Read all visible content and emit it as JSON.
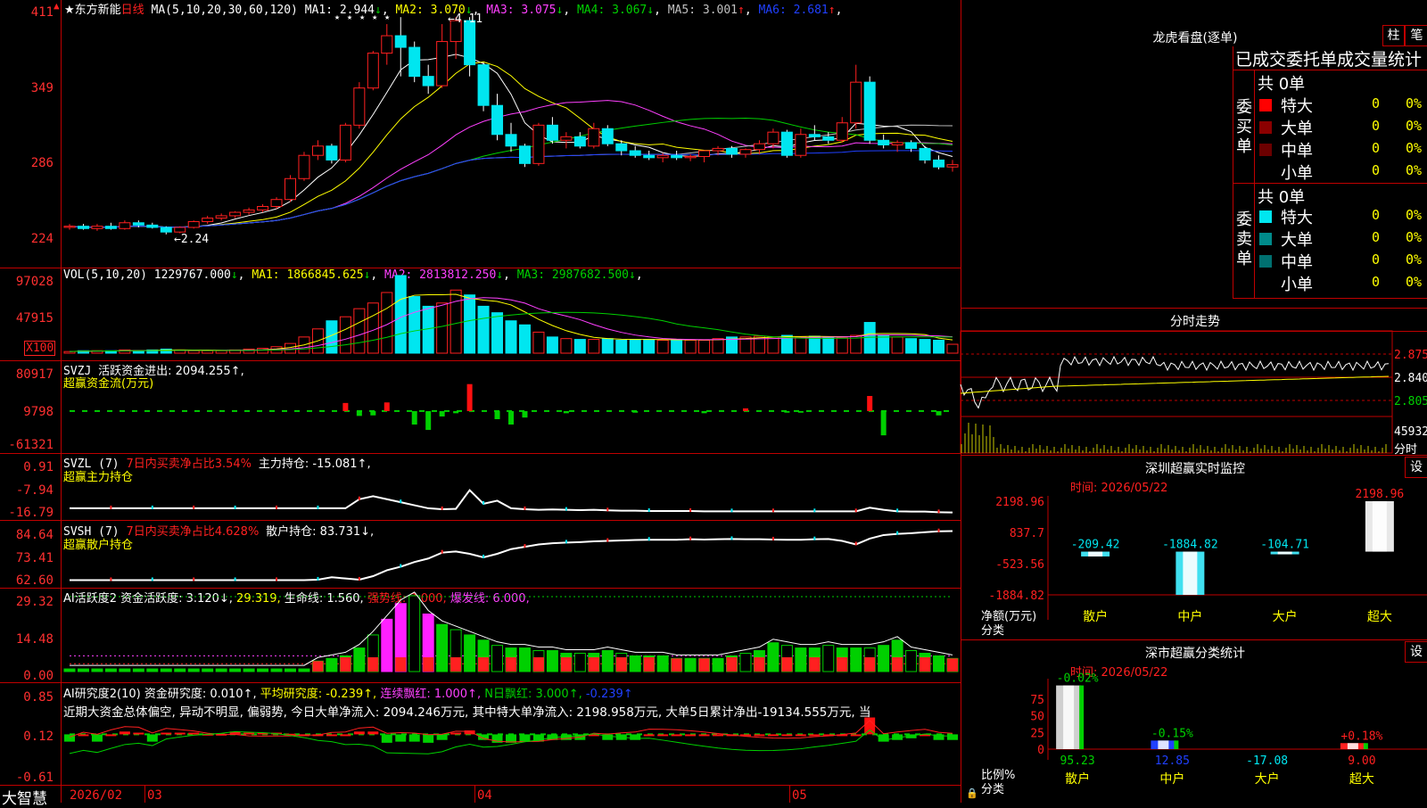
{
  "app": {
    "name": "大智慧",
    "period": "日线"
  },
  "stock": {
    "name": "东方新能"
  },
  "colors": {
    "up": "#ff2020",
    "down": "#00e6f0",
    "grid": "#c00000",
    "ma1": "#ffffff",
    "ma2": "#ffff00",
    "ma3": "#ff40ff",
    "ma4": "#00d000",
    "ma5": "#c0c0c0",
    "ma6": "#2040ff"
  },
  "kline": {
    "ma_title": "MA(5,10,20,30,60,120)",
    "ma_values": [
      {
        "label": "MA1:",
        "value": "2.944",
        "arrow": "↓",
        "color": "#ffffff"
      },
      {
        "label": "MA2:",
        "value": "3.070",
        "arrow": "↓",
        "color": "#ffff00"
      },
      {
        "label": "MA3:",
        "value": "3.075",
        "arrow": "↓",
        "color": "#ff40ff"
      },
      {
        "label": "MA4:",
        "value": "3.067",
        "arrow": "↓",
        "color": "#00d000"
      },
      {
        "label": "MA5:",
        "value": "3.001",
        "arrow": "↑",
        "color": "#c0c0c0"
      },
      {
        "label": "MA6:",
        "value": "2.681",
        "arrow": "↑",
        "color": "#2040ff"
      }
    ],
    "y_labels": [
      "411",
      "349",
      "286",
      "224"
    ],
    "high_mark": "4.11",
    "low_mark": "2.24",
    "stars": "★ ★ ★ ★   ★"
  },
  "vol": {
    "title": "VOL(5,10,20)",
    "value": "1229767.000",
    "ma": [
      {
        "label": "MA1:",
        "value": "1866845.625",
        "arrow": "↓",
        "color": "#ffff00"
      },
      {
        "label": "MA2:",
        "value": "2813812.250",
        "arrow": "↓",
        "color": "#ff40ff"
      },
      {
        "label": "MA3:",
        "value": "2987682.500",
        "arrow": "↓",
        "color": "#00d000"
      }
    ],
    "y_labels": [
      "97028",
      "47915"
    ],
    "unit": "X100"
  },
  "svzj": {
    "title": "SVZJ",
    "line1": "活跃资金进出: 2094.255↑,",
    "line2": "超赢资金流(万元)",
    "y_labels": [
      "80917",
      "9798",
      "-61321"
    ]
  },
  "svzl": {
    "title": "SVZL (7)",
    "ratio": "7日内买卖净占比3.54%",
    "main_hold": "主力持仓: -15.081↑,",
    "line2": "超赢主力持仓",
    "y_labels": [
      "0.91",
      "-7.94",
      "-16.79"
    ]
  },
  "svsh": {
    "title": "SVSH (7)",
    "ratio": "7日内买卖净占比4.628%",
    "retail_hold": "散户持仓: 83.731↓,",
    "line2": "超赢散户持仓",
    "y_labels": [
      "84.64",
      "73.41",
      "62.60"
    ]
  },
  "ai_active": {
    "title": "AI活跃度2",
    "fund": "资金活跃度: 3.120↓,",
    "v2": "29.319,",
    "life": "生命线: 1.560,",
    "strong": "强势线: 3.000,",
    "burst": "爆发线: 6.000,",
    "y_labels": [
      "29.32",
      "14.48",
      "0.00"
    ]
  },
  "ai_research": {
    "title": "AI研究度2(10)",
    "fund": "资金研究度: 0.010↑,",
    "avg": "平均研究度: -0.239↑,",
    "red": "连续飘红: 1.000↑,",
    "nred": "N日飘红: 3.000↑,",
    "last": "-0.239↑",
    "comment": "近期大资金总体偏空, 异动不明显, 偏弱势, 今日大单净流入: 2094.246万元, 其中特大单净流入: 2198.958万元, 大单5日累计净出-19134.555万元, 当",
    "y_labels": [
      "0.85",
      "0.12",
      "-0.61"
    ]
  },
  "time_axis": {
    "brand": "大智慧",
    "labels": [
      "2026/02",
      "03",
      "04",
      "05"
    ]
  },
  "right": {
    "lhb_title": "龙虎看盘(逐单)",
    "btn1": "柱",
    "btn2": "笔",
    "stats_title": "已成交委托单成交量统计",
    "buy": {
      "side": "委买单",
      "total": "共 0单",
      "rows": [
        {
          "color": "#ff0000",
          "label": "特大",
          "count": "0",
          "pct": "0%"
        },
        {
          "color": "#8b0000",
          "label": "大单",
          "count": "0",
          "pct": "0%"
        },
        {
          "color": "#6b0000",
          "label": "中单",
          "count": "0",
          "pct": "0%"
        },
        {
          "color": "",
          "label": "小单",
          "count": "0",
          "pct": "0%"
        }
      ]
    },
    "sell": {
      "side": "委卖单",
      "total": "共 0单",
      "rows": [
        {
          "color": "#00e6f0",
          "label": "特大",
          "count": "0",
          "pct": "0%"
        },
        {
          "color": "#008b8b",
          "label": "大单",
          "count": "0",
          "pct": "0%"
        },
        {
          "color": "#007070",
          "label": "中单",
          "count": "0",
          "pct": "0%"
        },
        {
          "color": "",
          "label": "小单",
          "count": "0",
          "pct": "0%"
        }
      ]
    },
    "intraday": {
      "title": "分时走势",
      "prices": [
        "2.875",
        "2.840",
        "2.805"
      ],
      "vol": "45932",
      "vol_unit": "分时"
    },
    "sz_monitor": {
      "title": "深圳超赢实时监控",
      "btn": "设",
      "time": "时间: 2026/05/22",
      "y_labels": [
        "2198.96",
        "837.7",
        "-523.56",
        "-1884.82"
      ],
      "ylabel1": "净额(万元)",
      "ylabel2": "分类",
      "bars": [
        {
          "cat": "散户",
          "value": -209.42,
          "label": "-209.42"
        },
        {
          "cat": "中户",
          "value": -1884.82,
          "label": "-1884.82"
        },
        {
          "cat": "大户",
          "value": -104.71,
          "label": "-104.71"
        },
        {
          "cat": "超大",
          "value": 2198.96,
          "label": "2198.96"
        }
      ]
    },
    "sz_class": {
      "title": "深市超赢分类统计",
      "btn": "设",
      "time": "时间: 2026/05/22",
      "y_ticks": [
        "75",
        "50",
        "25",
        "0"
      ],
      "ylabel1": "比例%",
      "ylabel2": "分类",
      "bars": [
        {
          "cat": "散户",
          "value": 95.23,
          "label": "95.23",
          "chg": "-0.02%"
        },
        {
          "cat": "中户",
          "value": 12.85,
          "label": "12.85",
          "chg": "-0.15%"
        },
        {
          "cat": "大户",
          "value": -17.08,
          "label": "-17.08",
          "chg": ""
        },
        {
          "cat": "超大",
          "value": 9.0,
          "label": "9.00",
          "chg": "+0.18%"
        }
      ]
    }
  },
  "chart_data": [
    {
      "type": "candlestick",
      "title": "东方新能 日线",
      "ylim": [
        2.2,
        4.15
      ],
      "ohlc": [
        [
          2.3,
          2.33,
          2.28,
          2.31
        ],
        [
          2.31,
          2.33,
          2.28,
          2.29
        ],
        [
          2.29,
          2.33,
          2.27,
          2.31
        ],
        [
          2.31,
          2.34,
          2.28,
          2.29
        ],
        [
          2.29,
          2.36,
          2.28,
          2.34
        ],
        [
          2.34,
          2.36,
          2.3,
          2.32
        ],
        [
          2.32,
          2.34,
          2.29,
          2.3
        ],
        [
          2.3,
          2.31,
          2.24,
          2.26
        ],
        [
          2.26,
          2.31,
          2.25,
          2.3
        ],
        [
          2.3,
          2.36,
          2.29,
          2.35
        ],
        [
          2.35,
          2.4,
          2.33,
          2.38
        ],
        [
          2.38,
          2.42,
          2.36,
          2.4
        ],
        [
          2.4,
          2.44,
          2.38,
          2.43
        ],
        [
          2.43,
          2.47,
          2.41,
          2.45
        ],
        [
          2.45,
          2.5,
          2.43,
          2.48
        ],
        [
          2.48,
          2.56,
          2.46,
          2.54
        ],
        [
          2.54,
          2.75,
          2.52,
          2.72
        ],
        [
          2.72,
          2.95,
          2.7,
          2.92
        ],
        [
          2.92,
          3.05,
          2.88,
          3.0
        ],
        [
          3.0,
          3.02,
          2.85,
          2.88
        ],
        [
          2.88,
          3.2,
          2.86,
          3.18
        ],
        [
          3.18,
          3.55,
          3.15,
          3.5
        ],
        [
          3.5,
          3.82,
          3.48,
          3.8
        ],
        [
          3.8,
          4.05,
          3.7,
          3.95
        ],
        [
          3.95,
          4.11,
          3.6,
          3.85
        ],
        [
          3.85,
          3.9,
          3.55,
          3.6
        ],
        [
          3.6,
          3.7,
          3.45,
          3.52
        ],
        [
          3.52,
          4.05,
          3.5,
          3.9
        ],
        [
          3.9,
          4.11,
          3.75,
          4.08
        ],
        [
          4.08,
          4.11,
          3.6,
          3.7
        ],
        [
          3.7,
          3.72,
          3.3,
          3.35
        ],
        [
          3.35,
          3.45,
          3.05,
          3.1
        ],
        [
          3.1,
          3.2,
          2.95,
          3.0
        ],
        [
          3.0,
          3.02,
          2.82,
          2.85
        ],
        [
          2.85,
          3.2,
          2.83,
          3.18
        ],
        [
          3.18,
          3.25,
          3.02,
          3.05
        ],
        [
          3.05,
          3.12,
          2.98,
          3.08
        ],
        [
          3.08,
          3.12,
          2.98,
          3.0
        ],
        [
          3.0,
          3.2,
          2.98,
          3.15
        ],
        [
          3.15,
          3.18,
          3.0,
          3.02
        ],
        [
          3.02,
          3.05,
          2.92,
          2.96
        ],
        [
          2.96,
          3.0,
          2.9,
          2.92
        ],
        [
          2.92,
          2.96,
          2.88,
          2.9
        ],
        [
          2.9,
          2.94,
          2.86,
          2.92
        ],
        [
          2.92,
          2.96,
          2.88,
          2.9
        ],
        [
          2.9,
          2.93,
          2.87,
          2.91
        ],
        [
          2.91,
          2.95,
          2.86,
          2.96
        ],
        [
          2.96,
          3.0,
          2.92,
          2.98
        ],
        [
          2.98,
          3.0,
          2.9,
          2.93
        ],
        [
          2.93,
          2.98,
          2.9,
          2.97
        ],
        [
          2.97,
          3.05,
          2.93,
          3.02
        ],
        [
          3.02,
          3.15,
          2.98,
          3.12
        ],
        [
          3.12,
          3.14,
          2.9,
          2.92
        ],
        [
          2.92,
          3.15,
          2.9,
          3.1
        ],
        [
          3.1,
          3.18,
          3.05,
          3.08
        ],
        [
          3.08,
          3.12,
          3.02,
          3.05
        ],
        [
          3.05,
          3.25,
          3.03,
          3.2
        ],
        [
          3.2,
          3.7,
          3.15,
          3.55
        ],
        [
          3.55,
          3.6,
          3.02,
          3.05
        ],
        [
          3.05,
          3.1,
          2.98,
          3.01
        ],
        [
          3.01,
          3.05,
          2.95,
          3.03
        ],
        [
          3.03,
          3.05,
          2.95,
          2.98
        ],
        [
          2.98,
          3.0,
          2.85,
          2.88
        ],
        [
          2.88,
          2.92,
          2.8,
          2.82
        ],
        [
          2.82,
          2.88,
          2.78,
          2.84
        ]
      ]
    },
    {
      "type": "bar",
      "title": "VOL(5,10,20)",
      "ylim": [
        0,
        97028
      ],
      "values": [
        2,
        3,
        3,
        3,
        4,
        3,
        4,
        5,
        4,
        3,
        3,
        3,
        4,
        5,
        6,
        8,
        12,
        20,
        30,
        40,
        45,
        55,
        62,
        75,
        96,
        70,
        58,
        62,
        78,
        72,
        58,
        50,
        40,
        35,
        26,
        20,
        18,
        17,
        17,
        18,
        16,
        17,
        17,
        16,
        17,
        16,
        16,
        18,
        20,
        20,
        21,
        20,
        22,
        20,
        21,
        20,
        19,
        22,
        38,
        22,
        20,
        18,
        17,
        16,
        11
      ]
    },
    {
      "type": "bar",
      "title": "SVZJ",
      "ylim": [
        -61321,
        80917
      ],
      "values": [
        0,
        0,
        0,
        0,
        0,
        0,
        0,
        0,
        0,
        0,
        0,
        0,
        0,
        0,
        0,
        0,
        0,
        0,
        0,
        0,
        15000,
        -9000,
        -8000,
        16000,
        0,
        -25000,
        -35000,
        -10000,
        -4000,
        50000,
        0,
        -15000,
        -25000,
        -12000,
        0,
        0,
        -4000,
        0,
        0,
        0,
        0,
        -3000,
        0,
        0,
        0,
        0,
        -4000,
        0,
        0,
        5000,
        0,
        0,
        -3000,
        -3000,
        0,
        0,
        0,
        0,
        28000,
        -45000,
        0,
        0,
        0,
        -8000,
        0
      ]
    },
    {
      "type": "line",
      "title": "SVZL (7)",
      "ylim": [
        -16.79,
        0.91
      ],
      "values": [
        -15,
        -15,
        -15,
        -15,
        -15,
        -15,
        -15,
        -15,
        -15,
        -15,
        -15,
        -15,
        -15,
        -15,
        -15,
        -15,
        -15,
        -15,
        -15,
        -15,
        -15,
        -12,
        -11,
        -12,
        -13,
        -14,
        -15,
        -15.3,
        -15.2,
        -9,
        -13.5,
        -12.5,
        -15,
        -15.3,
        -15.5,
        -15.4,
        -15.5,
        -15.6,
        -15.5,
        -15.7,
        -15.8,
        -15.8,
        -15.9,
        -15.9,
        -15.9,
        -15.9,
        -16.0,
        -16.0,
        -16.0,
        -16.0,
        -16.0,
        -16.0,
        -16.0,
        -16.0,
        -16.0,
        -16.0,
        -16.0,
        -16.0,
        -14.8,
        -15.5,
        -16.0,
        -16.1,
        -16.1,
        -16.3,
        -16.4
      ]
    },
    {
      "type": "line",
      "title": "SVSH (7)",
      "ylim": [
        62.6,
        84.64
      ],
      "values": [
        62.8,
        62.8,
        62.8,
        62.8,
        62.8,
        62.8,
        62.8,
        62.8,
        62.8,
        62.8,
        62.8,
        62.8,
        62.8,
        62.8,
        62.8,
        62.8,
        62.8,
        62.8,
        63,
        64,
        63.5,
        63.0,
        64.5,
        67,
        68.5,
        70.5,
        72,
        74.5,
        75,
        74,
        72.5,
        74,
        76,
        77,
        78,
        78.5,
        78.8,
        79,
        79.3,
        79.5,
        79.7,
        79.9,
        80,
        80,
        80,
        80.2,
        80.1,
        80.2,
        80.3,
        80.2,
        80.2,
        80.1,
        80,
        80,
        80.2,
        80.3,
        79.5,
        78,
        80.5,
        82,
        82.5,
        82.8,
        83.2,
        83.6,
        83.7
      ]
    },
    {
      "type": "bar",
      "title": "AI活跃度2",
      "ylim": [
        0,
        29.32
      ],
      "values": [
        1,
        1,
        1,
        1,
        1,
        1,
        1,
        1,
        1,
        1,
        1,
        1,
        1,
        1,
        1,
        1,
        1,
        1,
        4,
        5,
        6,
        9,
        14,
        20,
        26,
        29,
        22,
        18,
        16,
        14,
        12,
        10,
        9,
        9,
        8,
        8,
        7,
        7,
        7,
        8,
        7,
        6,
        6,
        6,
        5,
        5,
        5,
        5,
        6,
        7,
        8,
        11,
        10,
        9,
        9,
        10,
        9,
        9,
        9,
        10,
        12,
        8,
        7,
        6,
        5
      ]
    },
    {
      "type": "bar",
      "title": "AI研究度2(10)",
      "ylim": [
        -0.61,
        0.85
      ],
      "values": [
        -0.08,
        0.02,
        -0.08,
        0.02,
        0.1,
        0.08,
        -0.08,
        0.08,
        0.08,
        0.08,
        0.06,
        0.06,
        0.1,
        0.08,
        0.08,
        0.08,
        0.06,
        0.05,
        0.02,
        0.05,
        0.02,
        0.1,
        0.1,
        -0.1,
        -0.08,
        -0.08,
        -0.1,
        -0.05,
        0.08,
        0.12,
        -0.05,
        -0.1,
        -0.1,
        -0.08,
        -0.08,
        -0.05,
        -0.05,
        -0.05,
        0.02,
        -0.05,
        -0.05,
        -0.05,
        0.02,
        0.02,
        0.02,
        0.02,
        0.02,
        0.02,
        0.02,
        0.02,
        0.02,
        0.02,
        0.02,
        0.02,
        0.03,
        0.02,
        0.02,
        0.02,
        0.35,
        -0.08,
        -0.05,
        -0.02,
        0.02,
        -0.05,
        -0.05
      ]
    }
  ]
}
